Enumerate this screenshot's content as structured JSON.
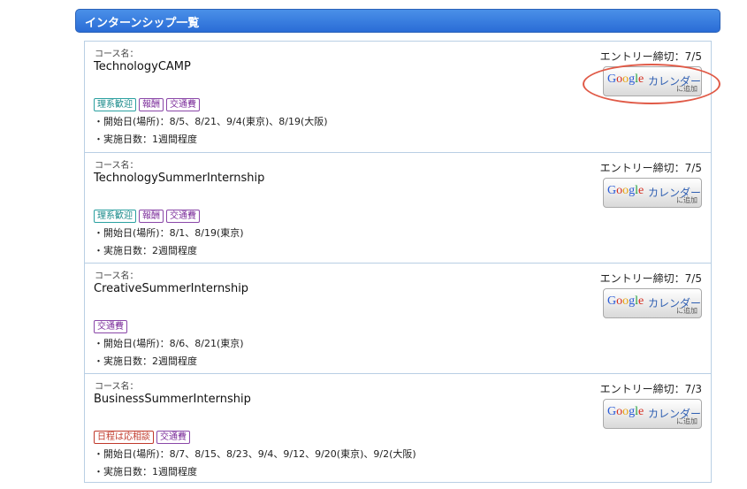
{
  "header": {
    "title": "インターンシップ一覧"
  },
  "items": [
    {
      "course_label": "コース名：",
      "course_name": "TechnologyCAMP",
      "deadline": "エントリー締切：7/5",
      "gcal": {
        "google": "Google",
        "text": "カレンダー",
        "sub": "に追加"
      },
      "tags": [
        "理系歓迎",
        "報酬",
        "交通費"
      ],
      "start": "・開始日(場所)：8/5、8/21、9/4(東京)、8/19(大阪)",
      "days": "・実施日数：1週間程度"
    },
    {
      "course_label": "コース名：",
      "course_name": "TechnologySummerInternship",
      "deadline": "エントリー締切：7/5",
      "gcal": {
        "google": "Google",
        "text": "カレンダー",
        "sub": "に追加"
      },
      "tags": [
        "理系歓迎",
        "報酬",
        "交通費"
      ],
      "start": "・開始日(場所)：8/1、8/19(東京)",
      "days": "・実施日数：2週間程度"
    },
    {
      "course_label": "コース名：",
      "course_name": "CreativeSummerInternship",
      "deadline": "エントリー締切：7/5",
      "gcal": {
        "google": "Google",
        "text": "カレンダー",
        "sub": "に追加"
      },
      "tags": [
        "交通費"
      ],
      "start": "・開始日(場所)：8/6、8/21(東京)",
      "days": "・実施日数：2週間程度"
    },
    {
      "course_label": "コース名：",
      "course_name": "BusinessSummerInternship",
      "deadline": "エントリー締切：7/3",
      "gcal": {
        "google": "Google",
        "text": "カレンダー",
        "sub": "に追加"
      },
      "tags": [
        "日程は応相談",
        "交通費"
      ],
      "start": "・開始日(場所)：8/7、8/15、8/23、9/4、9/12、9/20(東京)、9/2(大阪)",
      "days": "・実施日数：1週間程度"
    }
  ],
  "colors": {
    "header": "#2a6cd6",
    "tag_teal": "#1a8a8a",
    "tag_purple": "#7b2c9a",
    "tag_red": "#c0392b",
    "highlight": "#e05a47"
  }
}
